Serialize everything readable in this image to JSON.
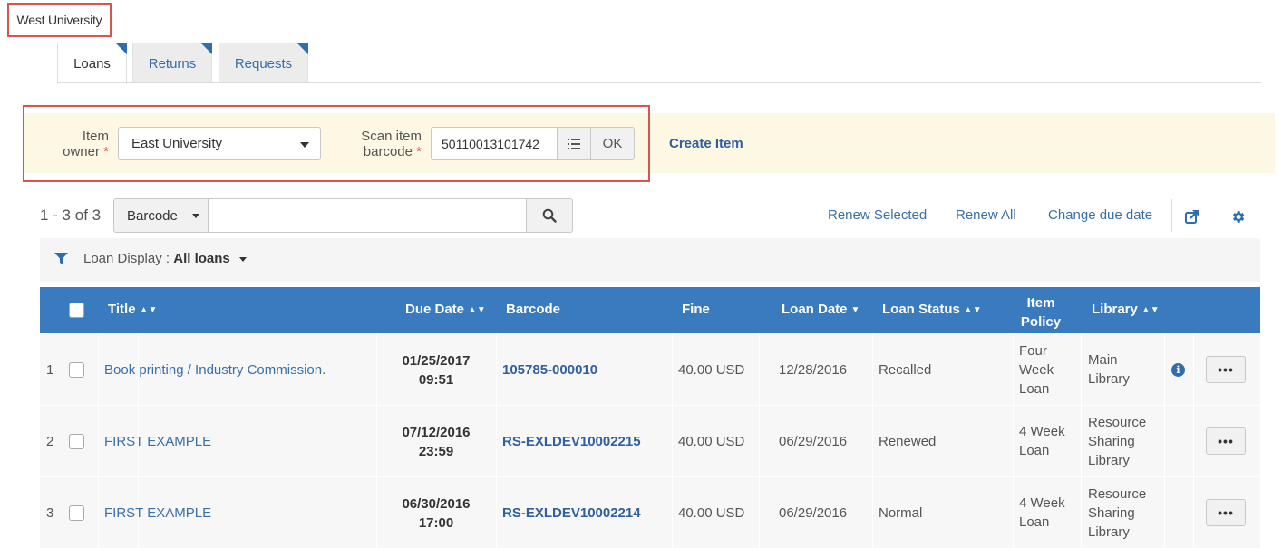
{
  "institution": "West University",
  "tabs": [
    {
      "label": "Loans",
      "active": true
    },
    {
      "label": "Returns",
      "active": false
    },
    {
      "label": "Requests",
      "active": false
    }
  ],
  "form": {
    "item_owner_label_1": "Item",
    "item_owner_label_2": "owner",
    "item_owner_value": "East University",
    "scan_label_1": "Scan item",
    "scan_label_2": "barcode",
    "required_mark": "*",
    "barcode_value": "50110013101742",
    "ok_label": "OK",
    "create_item_label": "Create Item"
  },
  "search": {
    "count_text": "1 - 3 of 3",
    "field_value": "Barcode",
    "query": ""
  },
  "actions": {
    "renew_selected": "Renew Selected",
    "renew_all": "Renew All",
    "change_due_date": "Change due date"
  },
  "filter": {
    "label": "Loan Display :",
    "value": "All loans"
  },
  "columns": {
    "title": "Title",
    "due_date": "Due Date",
    "barcode": "Barcode",
    "fine": "Fine",
    "loan_date": "Loan Date",
    "loan_status": "Loan Status",
    "item_policy_1": "Item",
    "item_policy_2": "Policy",
    "library": "Library"
  },
  "rows": [
    {
      "num": "1",
      "title": "Book printing / Industry Commission.",
      "due_date": "01/25/2017",
      "due_time": "09:51",
      "barcode": "105785-000010",
      "fine": "40.00 USD",
      "loan_date": "12/28/2016",
      "loan_status": "Recalled",
      "policy": [
        "Four",
        "Week",
        "Loan"
      ],
      "library": [
        "Main",
        "Library"
      ],
      "info": true
    },
    {
      "num": "2",
      "title": "FIRST EXAMPLE",
      "due_date": "07/12/2016",
      "due_time": "23:59",
      "barcode": "RS-EXLDEV10002215",
      "fine": "40.00 USD",
      "loan_date": "06/29/2016",
      "loan_status": "Renewed",
      "policy": [
        "4 Week",
        "Loan"
      ],
      "library": [
        "Resource",
        "Sharing",
        "Library"
      ],
      "info": false
    },
    {
      "num": "3",
      "title": "FIRST EXAMPLE",
      "due_date": "06/30/2016",
      "due_time": "17:00",
      "barcode": "RS-EXLDEV10002214",
      "fine": "40.00 USD",
      "loan_date": "06/29/2016",
      "loan_status": "Normal",
      "policy": [
        "4 Week",
        "Loan"
      ],
      "library": [
        "Resource",
        "Sharing",
        "Library"
      ],
      "info": false
    }
  ],
  "row_menu_label": "•••",
  "info_glyph": "i",
  "icons": [
    "filter-icon",
    "search-icon",
    "list-icon",
    "external-link-icon",
    "gear-icon",
    "info-icon",
    "sort-icon",
    "caret-down-icon"
  ],
  "colors": {
    "accent": "#3a7bbf",
    "alert_border": "#d9534f",
    "highlight_bg": "#fcf8e3",
    "link": "#3a6fa9"
  }
}
